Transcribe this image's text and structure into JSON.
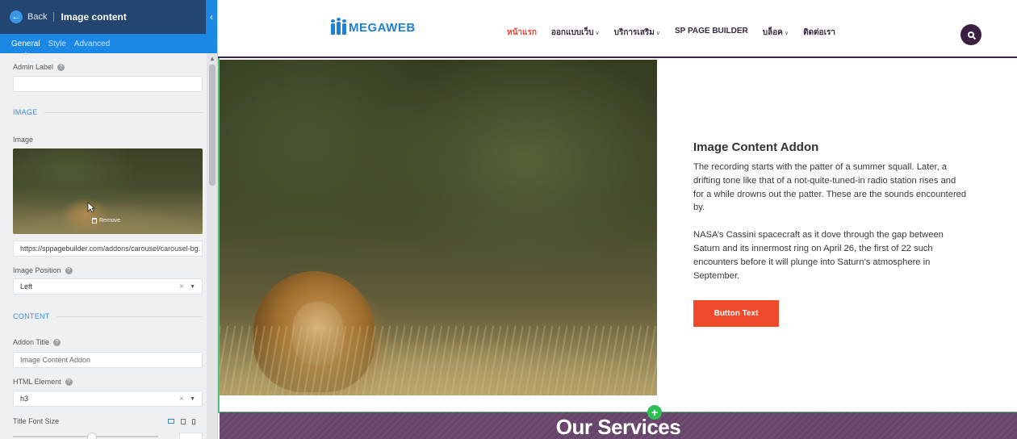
{
  "panel": {
    "back_label": "Back",
    "title": "Image content",
    "tabs": [
      "General",
      "Style",
      "Advanced"
    ],
    "fields": {
      "admin_label": "Admin Label",
      "admin_label_value": "",
      "section_image": "IMAGE",
      "image_label": "Image",
      "remove_label": "Remove",
      "image_url": "https://sppagebuilder.com/addons/carousel/carousel-bg.",
      "image_position_label": "Image Position",
      "image_position_value": "Left",
      "section_content": "CONTENT",
      "addon_title_label": "Addon Title",
      "addon_title_placeholder": "Image Content Addon",
      "html_element_label": "HTML Element",
      "html_element_value": "h3",
      "title_font_size_label": "Title Font Size"
    }
  },
  "site": {
    "logo_text": "MEGAWEB",
    "menu": [
      {
        "label": "หน้าแรก",
        "active": true,
        "dropdown": false
      },
      {
        "label": "ออกแบบเว็บ",
        "active": false,
        "dropdown": true
      },
      {
        "label": "บริการเสริม",
        "active": false,
        "dropdown": true
      },
      {
        "label": "SP PAGE BUILDER",
        "active": false,
        "dropdown": false
      },
      {
        "label": "บล็อค",
        "active": false,
        "dropdown": true
      },
      {
        "label": "ติดต่อเรา",
        "active": false,
        "dropdown": false
      }
    ],
    "content": {
      "title": "Image Content Addon",
      "paragraph1": "The recording starts with the patter of a summer squall. Later, a drifting tone like that of a not-quite-tuned-in radio station rises and for a while drowns out the patter. These are the sounds encountered by.",
      "paragraph2": "NASA’s Cassini spacecraft as it dove through the gap between Saturn and its innermost ring on April 26, the first of 22 such encounters before it will plunge into Saturn’s atmosphere in September.",
      "button_text": "Button Text"
    },
    "services_title": "Our Services"
  },
  "colors": {
    "panel_header": "#24456f",
    "panel_tabs": "#1c88e6",
    "accent_orange": "#f0492b",
    "nav_dark": "#3b1f42",
    "logo_blue": "#1f7fd1",
    "add_green": "#2fbf55"
  },
  "icons": {
    "back": "arrow-left-icon",
    "collapse": "chevron-left-icon",
    "help": "help-icon",
    "remove": "trash-icon",
    "search": "search-icon",
    "add": "plus-icon"
  }
}
